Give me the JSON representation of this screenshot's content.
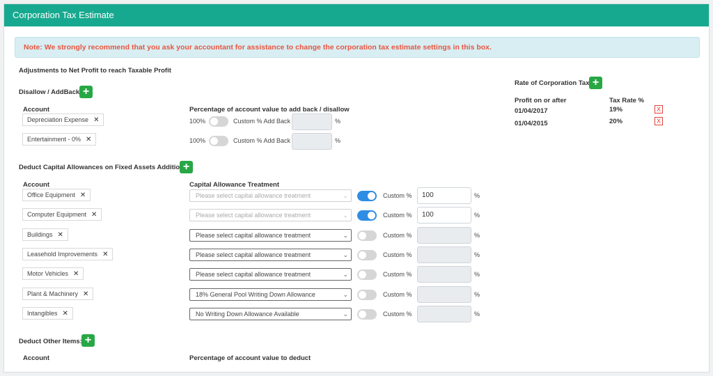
{
  "header": {
    "title": "Corporation Tax Estimate"
  },
  "note": "Note: We strongly recommend that you ask your accountant for assistance to change the corporation tax estimate settings in this box.",
  "adjustments_heading": "Adjustments to Net Profit to reach Taxable Profit",
  "disallow": {
    "heading": "Disallow / AddBack:",
    "col_account": "Account",
    "col_percentage": "Percentage of account value to add back / disallow",
    "rows": [
      {
        "account": "Depreciation Expense",
        "percent": "100%",
        "custom_label": "Custom % Add Back",
        "unit": "%"
      },
      {
        "account": "Entertainment - 0%",
        "percent": "100%",
        "custom_label": "Custom % Add Back",
        "unit": "%"
      }
    ]
  },
  "capital": {
    "heading": "Deduct Capital Allowances on Fixed Assets Additions:",
    "col_account": "Account",
    "col_treatment": "Capital Allowance Treatment",
    "custom_label": "Custom %",
    "unit": "%",
    "rows": [
      {
        "account": "Office Equipment",
        "treatment": "Please select capital allowance treatment",
        "custom_value": "100"
      },
      {
        "account": "Computer Equipment",
        "treatment": "Please select capital allowance treatment",
        "custom_value": "100"
      },
      {
        "account": "Buildings",
        "treatment": "Please select capital allowance treatment",
        "custom_value": ""
      },
      {
        "account": "Leasehold Improvements",
        "treatment": "Please select capital allowance treatment",
        "custom_value": ""
      },
      {
        "account": "Motor Vehicles",
        "treatment": "Please select capital allowance treatment",
        "custom_value": ""
      },
      {
        "account": "Plant & Machinery",
        "treatment": "18% General Pool Writing Down Allowance",
        "custom_value": ""
      },
      {
        "account": "Intangibles",
        "treatment": "No Writing Down Allowance Available",
        "custom_value": ""
      }
    ]
  },
  "other": {
    "heading": "Deduct Other Items:",
    "col_account": "Account",
    "col_percentage": "Percentage of account value to deduct"
  },
  "rate": {
    "heading": "Rate of Corporation Tax:",
    "col_profit": "Profit on or after",
    "col_rate": "Tax Rate %",
    "delete_label": "X",
    "rows": [
      {
        "date": "01/04/2017",
        "rate": "19%"
      },
      {
        "date": "01/04/2015",
        "rate": "20%"
      }
    ]
  },
  "icons": {
    "add": "+",
    "remove": "✕",
    "chevron": "⌄"
  },
  "colors": {
    "header": "#17a98f",
    "note_text": "#e9553f",
    "add_button": "#28a745",
    "toggle_on": "#2f8de4"
  }
}
